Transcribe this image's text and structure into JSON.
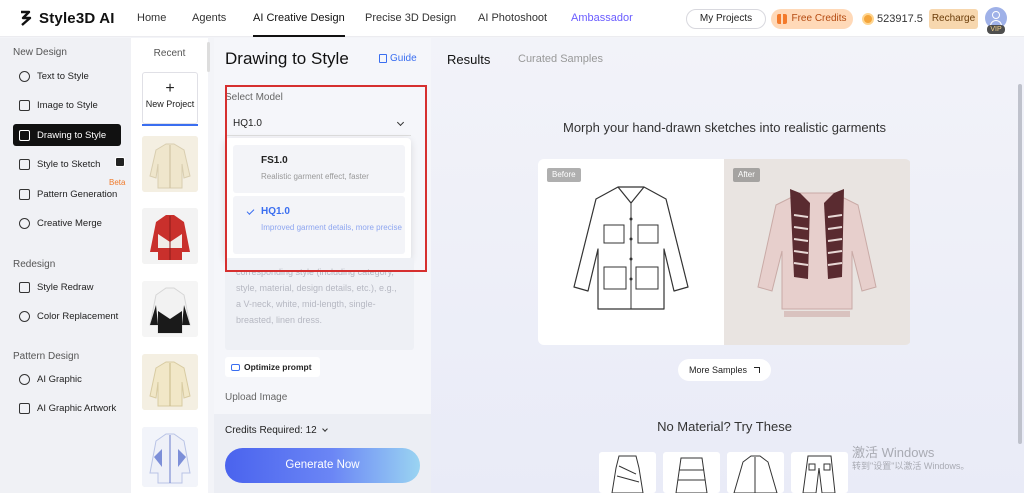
{
  "brand": {
    "name": "Style3D AI"
  },
  "nav": [
    "Home",
    "Agents",
    "AI Creative Design",
    "Precise 3D Design",
    "AI Photoshoot",
    "Ambassador"
  ],
  "header": {
    "my_projects": "My Projects",
    "free_credits": "Free Credits",
    "balance": "523917.5",
    "recharge": "Recharge",
    "vip": "VIP"
  },
  "sidebar": {
    "sections": [
      {
        "title": "New Design",
        "items": [
          "Text to Style",
          "Image to Style",
          "Drawing to Style",
          "Style to Sketch",
          "Pattern Generation",
          "Creative Merge"
        ]
      },
      {
        "title": "Redesign",
        "items": [
          "Style Redraw",
          "Color Replacement"
        ]
      },
      {
        "title": "Pattern Design",
        "items": [
          "AI Graphic",
          "AI Graphic Artwork"
        ]
      }
    ],
    "active": "Drawing to Style",
    "beta": "Beta"
  },
  "recent": {
    "title": "Recent",
    "new_project": "New Project",
    "plus": "+"
  },
  "form": {
    "title": "Drawing to Style",
    "guide": "Guide",
    "select_model_label": "Select Model",
    "selected_model": "HQ1.0",
    "options": [
      {
        "name": "FS1.0",
        "desc": "Realistic garment effect, faster"
      },
      {
        "name": "HQ1.0",
        "desc": "Improved garment details, more precise"
      }
    ],
    "prompt_placeholder": "corresponding style (including category, style, material, design details, etc.), e.g., a V-neck, white, mid-length, single-breasted, linen dress.",
    "optimize": "Optimize prompt",
    "upload_label": "Upload Image",
    "credits": "Credits Required: 12",
    "generate": "Generate Now"
  },
  "results": {
    "tab_results": "Results",
    "tab_curated": "Curated Samples",
    "headline": "Morph your hand-drawn sketches into realistic garments",
    "before": "Before",
    "after": "After",
    "more_samples": "More Samples",
    "no_material": "No Material? Try These"
  },
  "watermark": {
    "line1": "激活 Windows",
    "line2": "转到\"设置\"以激活 Windows。"
  }
}
